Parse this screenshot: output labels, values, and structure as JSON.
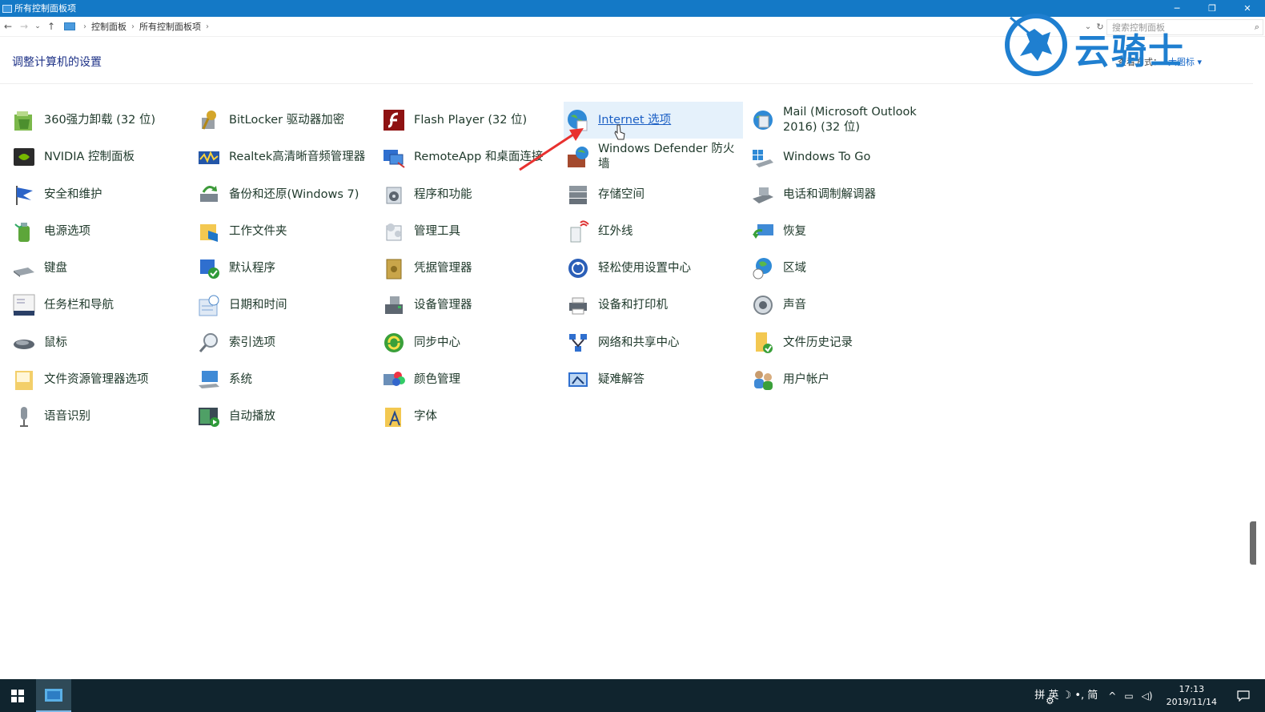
{
  "window": {
    "title": "所有控制面板项",
    "controls": {
      "minimize": "─",
      "restore": "❐",
      "close": "✕"
    }
  },
  "address": {
    "crumbs": [
      "控制面板",
      "所有控制面板项"
    ],
    "search_placeholder": "搜索控制面板"
  },
  "header": {
    "title": "调整计算机的设置",
    "view_by_label": "查看方式：",
    "view_by_value": "大图标 ▾"
  },
  "watermark": {
    "text": "云骑士"
  },
  "items": {
    "c0": [
      "360强力卸载 (32 位)",
      "NVIDIA 控制面板",
      "安全和维护",
      "电源选项",
      "键盘",
      "任务栏和导航",
      "鼠标",
      "文件资源管理器选项",
      "语音识别"
    ],
    "c1": [
      "BitLocker 驱动器加密",
      "Realtek高清晰音频管理器",
      "备份和还原(Windows 7)",
      "工作文件夹",
      "默认程序",
      "日期和时间",
      "索引选项",
      "系统",
      "自动播放"
    ],
    "c2": [
      "Flash Player (32 位)",
      "RemoteApp 和桌面连接",
      "程序和功能",
      "管理工具",
      "凭据管理器",
      "设备管理器",
      "同步中心",
      "颜色管理",
      "字体"
    ],
    "c3": [
      "Internet 选项",
      "Windows Defender 防火墙",
      "存储空间",
      "红外线",
      "轻松使用设置中心",
      "设备和打印机",
      "网络和共享中心",
      "疑难解答"
    ],
    "c4": [
      "Mail (Microsoft Outlook 2016) (32 位)",
      "Windows To Go",
      "电话和调制解调器",
      "恢复",
      "区域",
      "声音",
      "文件历史记录",
      "用户帐户"
    ]
  },
  "taskbar": {
    "ime": "拼 英 ☽ •, 简",
    "time": "17:13",
    "date": "2019/11/14"
  },
  "colors": {
    "titlebar": "#1479c6",
    "taskbar": "#10242e",
    "highlight": "#e5f1fb",
    "accent_link": "#1b5fc4"
  }
}
